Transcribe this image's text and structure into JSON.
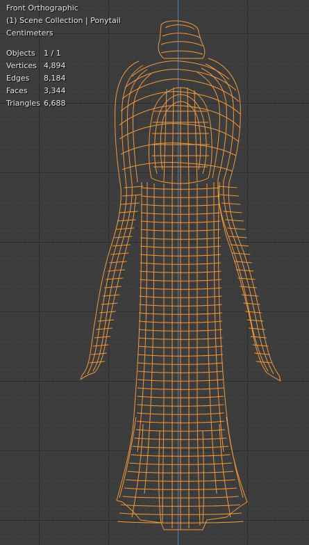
{
  "viewport": {
    "view_name": "Front Orthographic",
    "collection": "(1) Scene Collection | Ponytail",
    "units": "Centimeters"
  },
  "stats": [
    {
      "label": "Objects",
      "value": "1 / 1"
    },
    {
      "label": "Vertices",
      "value": "4,894"
    },
    {
      "label": "Edges",
      "value": "8,184"
    },
    {
      "label": "Faces",
      "value": "3,344"
    },
    {
      "label": "Triangles",
      "value": "6,688"
    }
  ],
  "colors": {
    "background": "#3d3d3d",
    "wire_selected": "#f29a3b",
    "axis_z": "#5a7fb8",
    "text": "#e6e6e6"
  }
}
